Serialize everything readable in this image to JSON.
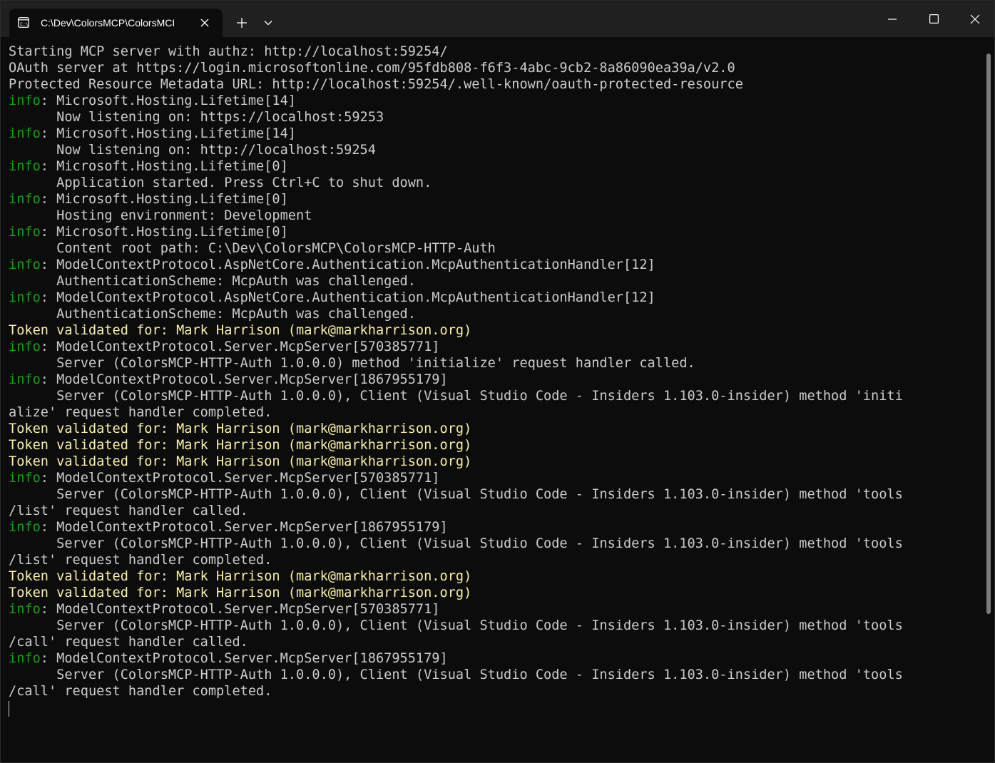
{
  "window": {
    "tab_title": "C:\\Dev\\ColorsMCP\\ColorsMCI",
    "tab_icon": "terminal-icon",
    "new_tab_icon": "plus-icon",
    "dropdown_icon": "chevron-down-icon",
    "controls": [
      "minimize-icon",
      "maximize-icon",
      "close-icon"
    ]
  },
  "colors": {
    "background": "#0c0c0c",
    "titlebar": "#202020",
    "text": "#cccccc",
    "info_level": "#13a10e",
    "token_line": "#f9f1a5"
  },
  "terminal": {
    "lines": [
      {
        "type": "plain",
        "text": "Starting MCP server with authz: http://localhost:59254/"
      },
      {
        "type": "plain",
        "text": "OAuth server at https://login.microsoftonline.com/95fdb808-f6f3-4abc-9cb2-8a86090ea39a/v2.0"
      },
      {
        "type": "plain",
        "text": "Protected Resource Metadata URL: http://localhost:59254/.well-known/oauth-protected-resource"
      },
      {
        "type": "info",
        "level": "info",
        "text": ": Microsoft.Hosting.Lifetime[14]"
      },
      {
        "type": "plain",
        "text": "      Now listening on: https://localhost:59253"
      },
      {
        "type": "info",
        "level": "info",
        "text": ": Microsoft.Hosting.Lifetime[14]"
      },
      {
        "type": "plain",
        "text": "      Now listening on: http://localhost:59254"
      },
      {
        "type": "info",
        "level": "info",
        "text": ": Microsoft.Hosting.Lifetime[0]"
      },
      {
        "type": "plain",
        "text": "      Application started. Press Ctrl+C to shut down."
      },
      {
        "type": "info",
        "level": "info",
        "text": ": Microsoft.Hosting.Lifetime[0]"
      },
      {
        "type": "plain",
        "text": "      Hosting environment: Development"
      },
      {
        "type": "info",
        "level": "info",
        "text": ": Microsoft.Hosting.Lifetime[0]"
      },
      {
        "type": "plain",
        "text": "      Content root path: C:\\Dev\\ColorsMCP\\ColorsMCP-HTTP-Auth"
      },
      {
        "type": "info",
        "level": "info",
        "text": ": ModelContextProtocol.AspNetCore.Authentication.McpAuthenticationHandler[12]"
      },
      {
        "type": "plain",
        "text": "      AuthenticationScheme: McpAuth was challenged."
      },
      {
        "type": "info",
        "level": "info",
        "text": ": ModelContextProtocol.AspNetCore.Authentication.McpAuthenticationHandler[12]"
      },
      {
        "type": "plain",
        "text": "      AuthenticationScheme: McpAuth was challenged."
      },
      {
        "type": "token",
        "text": "Token validated for: Mark Harrison (mark@markharrison.org)"
      },
      {
        "type": "info",
        "level": "info",
        "text": ": ModelContextProtocol.Server.McpServer[570385771]"
      },
      {
        "type": "plain",
        "text": "      Server (ColorsMCP-HTTP-Auth 1.0.0.0) method 'initialize' request handler called."
      },
      {
        "type": "info",
        "level": "info",
        "text": ": ModelContextProtocol.Server.McpServer[1867955179]"
      },
      {
        "type": "plain",
        "text": "      Server (ColorsMCP-HTTP-Auth 1.0.0.0), Client (Visual Studio Code - Insiders 1.103.0-insider) method 'initi"
      },
      {
        "type": "plain",
        "text": "alize' request handler completed."
      },
      {
        "type": "token",
        "text": "Token validated for: Mark Harrison (mark@markharrison.org)"
      },
      {
        "type": "token",
        "text": "Token validated for: Mark Harrison (mark@markharrison.org)"
      },
      {
        "type": "token",
        "text": "Token validated for: Mark Harrison (mark@markharrison.org)"
      },
      {
        "type": "info",
        "level": "info",
        "text": ": ModelContextProtocol.Server.McpServer[570385771]"
      },
      {
        "type": "plain",
        "text": "      Server (ColorsMCP-HTTP-Auth 1.0.0.0), Client (Visual Studio Code - Insiders 1.103.0-insider) method 'tools"
      },
      {
        "type": "plain",
        "text": "/list' request handler called."
      },
      {
        "type": "info",
        "level": "info",
        "text": ": ModelContextProtocol.Server.McpServer[1867955179]"
      },
      {
        "type": "plain",
        "text": "      Server (ColorsMCP-HTTP-Auth 1.0.0.0), Client (Visual Studio Code - Insiders 1.103.0-insider) method 'tools"
      },
      {
        "type": "plain",
        "text": "/list' request handler completed."
      },
      {
        "type": "token",
        "text": "Token validated for: Mark Harrison (mark@markharrison.org)"
      },
      {
        "type": "token",
        "text": "Token validated for: Mark Harrison (mark@markharrison.org)"
      },
      {
        "type": "info",
        "level": "info",
        "text": ": ModelContextProtocol.Server.McpServer[570385771]"
      },
      {
        "type": "plain",
        "text": "      Server (ColorsMCP-HTTP-Auth 1.0.0.0), Client (Visual Studio Code - Insiders 1.103.0-insider) method 'tools"
      },
      {
        "type": "plain",
        "text": "/call' request handler called."
      },
      {
        "type": "info",
        "level": "info",
        "text": ": ModelContextProtocol.Server.McpServer[1867955179]"
      },
      {
        "type": "plain",
        "text": "      Server (ColorsMCP-HTTP-Auth 1.0.0.0), Client (Visual Studio Code - Insiders 1.103.0-insider) method 'tools"
      },
      {
        "type": "plain",
        "text": "/call' request handler completed."
      }
    ]
  }
}
